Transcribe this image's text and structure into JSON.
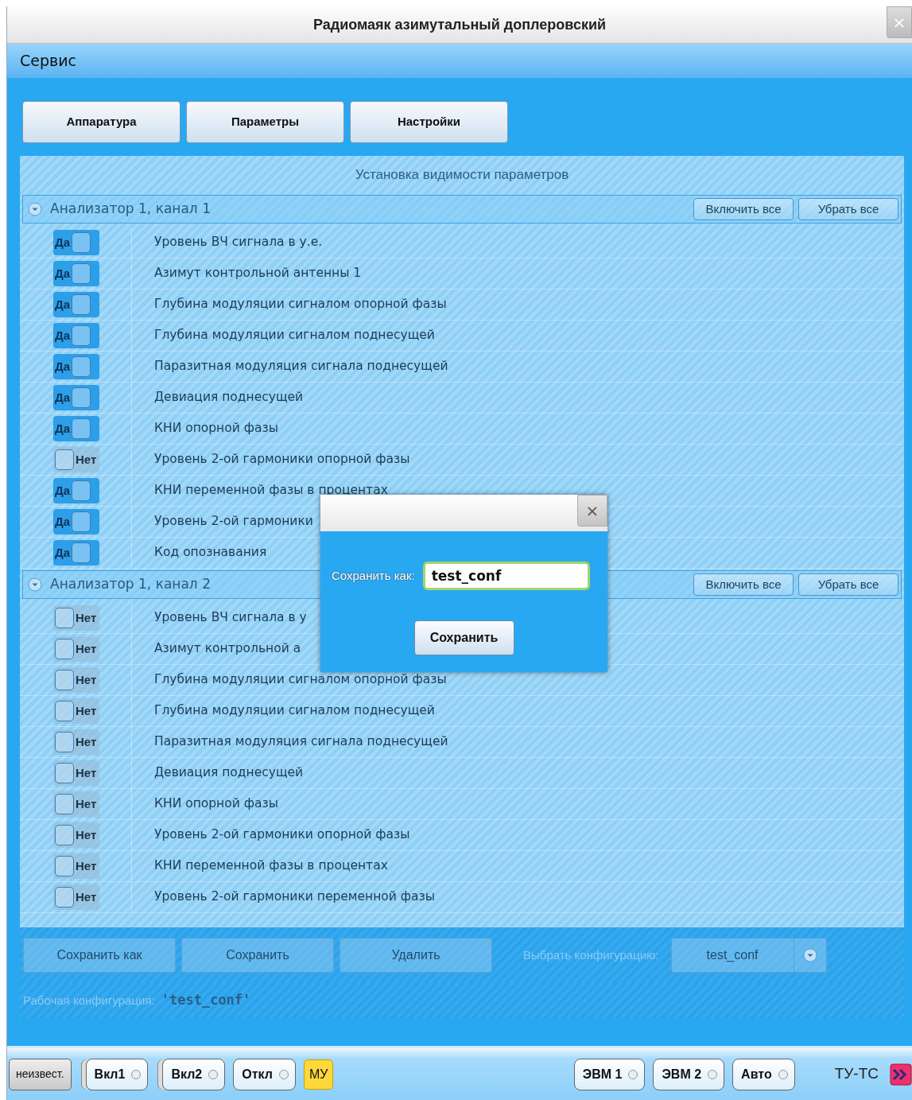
{
  "window": {
    "title": "Радиомаяк азимутальный доплеровский",
    "close": "×"
  },
  "menu": [
    {
      "label": "Сервис"
    }
  ],
  "tabs": [
    {
      "label": "Аппаратура"
    },
    {
      "label": "Параметры"
    },
    {
      "label": "Настройки"
    }
  ],
  "panel": {
    "title": "Установка видимости параметров",
    "groups": [
      {
        "title": "Анализатор 1, канал 1",
        "expanded": true,
        "buttons": [
          "Включить все",
          "Убрать все"
        ],
        "rows": [
          {
            "toggle": "Да",
            "on": true,
            "label": "Уровень ВЧ сигнала в у.е."
          },
          {
            "toggle": "Да",
            "on": true,
            "label": "Азимут контрольной антенны 1"
          },
          {
            "toggle": "Да",
            "on": true,
            "label": "Глубина модуляции сигналом опорной фазы"
          },
          {
            "toggle": "Да",
            "on": true,
            "label": "Глубина модуляции сигналом поднесущей"
          },
          {
            "toggle": "Да",
            "on": true,
            "label": "Паразитная модуляция сигнала поднесущей"
          },
          {
            "toggle": "Да",
            "on": true,
            "label": "Девиация поднесущей"
          },
          {
            "toggle": "Да",
            "on": true,
            "label": "КНИ опорной фазы"
          },
          {
            "toggle": "Нет",
            "on": false,
            "label": "Уровень 2-ой гармоники опорной фазы"
          },
          {
            "toggle": "Да",
            "on": true,
            "label": "КНИ переменной фазы в процентах"
          },
          {
            "toggle": "Да",
            "on": true,
            "label": "Уровень 2-ой гармоники"
          },
          {
            "toggle": "Да",
            "on": true,
            "label": "Код опознавания"
          }
        ]
      },
      {
        "title": "Анализатор 1, канал 2",
        "expanded": true,
        "buttons": [
          "Включить все",
          "Убрать все"
        ],
        "rows": [
          {
            "toggle": "Нет",
            "on": false,
            "label": "Уровень ВЧ сигнала в у"
          },
          {
            "toggle": "Нет",
            "on": false,
            "label": "Азимут контрольной а"
          },
          {
            "toggle": "Нет",
            "on": false,
            "label": "Глубина модуляции сигналом опорной фазы"
          },
          {
            "toggle": "Нет",
            "on": false,
            "label": "Глубина модуляции сигналом поднесущей"
          },
          {
            "toggle": "Нет",
            "on": false,
            "label": "Паразитная модуляция сигнала поднесущей"
          },
          {
            "toggle": "Нет",
            "on": false,
            "label": "Девиация поднесущей"
          },
          {
            "toggle": "Нет",
            "on": false,
            "label": "КНИ опорной фазы"
          },
          {
            "toggle": "Нет",
            "on": false,
            "label": "Уровень 2-ой гармоники опорной фазы"
          },
          {
            "toggle": "Нет",
            "on": false,
            "label": "КНИ переменной фазы в процентах"
          },
          {
            "toggle": "Нет",
            "on": false,
            "label": "Уровень 2-ой гармоники переменной фазы"
          }
        ]
      }
    ]
  },
  "actions": [
    "Сохранить как",
    "Сохранить",
    "Удалить"
  ],
  "config_select": {
    "label": "Выбрать конфигурацию:",
    "value": "test_conf"
  },
  "working_config": {
    "label": "Рабочая конфигурация:",
    "value": "'test_conf'"
  },
  "dialog": {
    "close": "×",
    "label": "Сохранить как:",
    "value": "test_conf",
    "button": "Сохранить"
  },
  "status_bar": {
    "left": [
      {
        "kind": "plain",
        "label": "неизвест."
      },
      {
        "kind": "stacked-radio",
        "label": "Вкл1"
      },
      {
        "kind": "stacked-radio",
        "label": "Вкл2"
      },
      {
        "kind": "radio",
        "label": "Откл"
      },
      {
        "kind": "flag",
        "label": "МУ"
      }
    ],
    "right": [
      {
        "kind": "radio",
        "label": "ЭВМ 1"
      },
      {
        "kind": "radio",
        "label": "ЭВМ 2"
      },
      {
        "kind": "radio",
        "label": "Авто"
      },
      {
        "kind": "text",
        "label": "ТУ-ТС"
      }
    ]
  }
}
